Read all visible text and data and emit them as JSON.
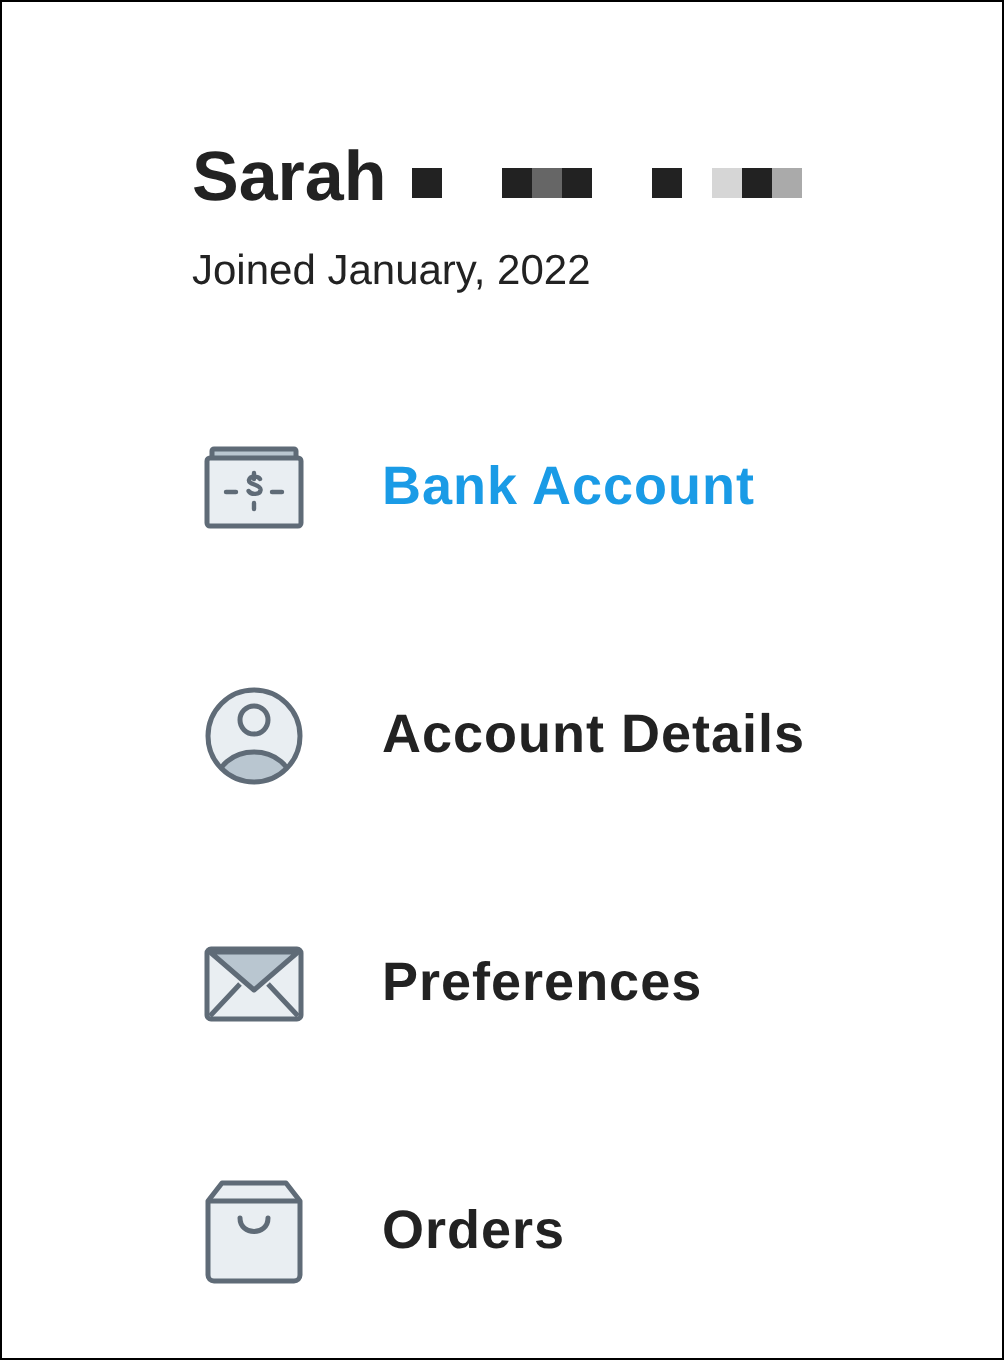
{
  "profile": {
    "first_name": "Sarah",
    "joined": "Joined January, 2022"
  },
  "menu": [
    {
      "label": "Bank Account",
      "kind": "bank",
      "selected": true
    },
    {
      "label": "Account Details",
      "kind": "person",
      "selected": false
    },
    {
      "label": "Preferences",
      "kind": "mail",
      "selected": false
    },
    {
      "label": "Orders",
      "kind": "bag",
      "selected": false
    }
  ]
}
